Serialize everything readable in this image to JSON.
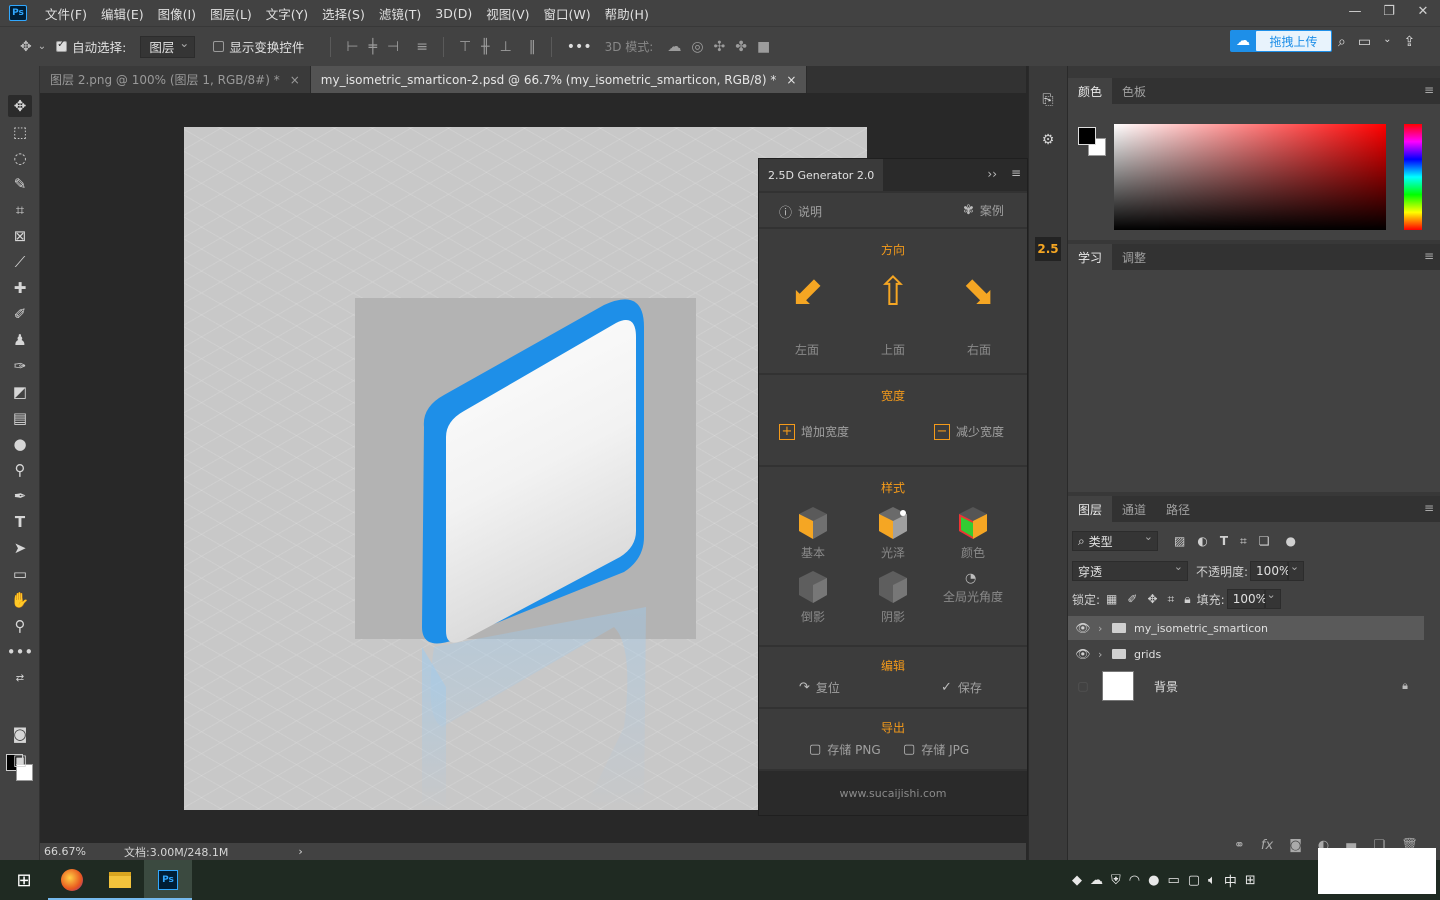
{
  "menu": {
    "logo": "Ps",
    "items": [
      "文件(F)",
      "编辑(E)",
      "图像(I)",
      "图层(L)",
      "文字(Y)",
      "选择(S)",
      "滤镜(T)",
      "3D(D)",
      "视图(V)",
      "窗口(W)",
      "帮助(H)"
    ],
    "window_controls": [
      "—",
      "❐",
      "✕"
    ]
  },
  "options": {
    "auto_select_label": "自动选择:",
    "auto_select_value": "图层",
    "show_transform_label": "显示变换控件",
    "mode_3d_label": "3D 模式:",
    "upload_label": "拖拽上传"
  },
  "tabs": [
    {
      "title": "图层 2.png @ 100% (图层 1, RGB/8#) *",
      "close": "×"
    },
    {
      "title": "my_isometric_smarticon-2.psd @ 66.7% (my_isometric_smarticon, RGB/8) *",
      "close": "×"
    }
  ],
  "status": {
    "zoom": "66.67%",
    "doc": "文档:3.00M/248.1M",
    "arrow": "›"
  },
  "generator": {
    "title": "2.5D Generator 2.0",
    "help": "说明",
    "examples": "案例",
    "direction_title": "方向",
    "directions": [
      "左面",
      "上面",
      "右面"
    ],
    "width_title": "宽度",
    "increase": "增加宽度",
    "decrease": "减少宽度",
    "style_title": "样式",
    "styles": [
      "基本",
      "光泽",
      "颜色",
      "倒影",
      "阴影",
      "全局光角度"
    ],
    "edit_title": "编辑",
    "reset": "复位",
    "save": "保存",
    "export_title": "导出",
    "save_png": "存储 PNG",
    "save_jpg": "存储 JPG",
    "footer": "www.sucaijishi.com"
  },
  "dock": {
    "badge": "2.5"
  },
  "color_panel": {
    "tabs": [
      "颜色",
      "色板"
    ]
  },
  "learn_panel": {
    "tabs": [
      "学习",
      "调整"
    ]
  },
  "layers_panel": {
    "tabs": [
      "图层",
      "通道",
      "路径"
    ],
    "filter_kind": "类型",
    "blend_mode": "穿透",
    "opacity_label": "不透明度:",
    "opacity_value": "100%",
    "lock_label": "锁定:",
    "fill_label": "填充:",
    "fill_value": "100%",
    "layers": [
      {
        "name": "my_isometric_smarticon",
        "type": "group",
        "visible": true,
        "selected": true
      },
      {
        "name": "grids",
        "type": "group",
        "visible": true,
        "selected": false
      },
      {
        "name": "背景",
        "type": "image",
        "visible": false,
        "selected": false
      }
    ]
  },
  "taskbar": {
    "tray_ime": "中"
  },
  "colors": {
    "accent_orange": "#f49a1a",
    "icon_blue": "#1e8fe8",
    "ui_dark": "#424242"
  }
}
